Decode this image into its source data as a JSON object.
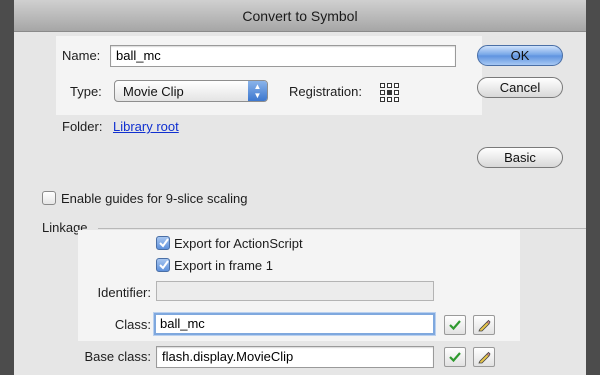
{
  "dialog": {
    "title": "Convert to Symbol"
  },
  "form": {
    "name_label": "Name:",
    "name_value": "ball_mc",
    "type_label": "Type:",
    "type_value": "Movie Clip",
    "registration_label": "Registration:",
    "folder_label": "Folder:",
    "folder_link": "Library root"
  },
  "buttons": {
    "ok": "OK",
    "cancel": "Cancel",
    "basic": "Basic"
  },
  "options": {
    "nine_slice": "Enable guides for 9-slice scaling",
    "nine_slice_checked": false
  },
  "linkage": {
    "title": "Linkage",
    "export_actionscript": "Export for ActionScript",
    "export_actionscript_checked": true,
    "export_frame1": "Export in frame 1",
    "export_frame1_checked": true,
    "identifier_label": "Identifier:",
    "identifier_value": "",
    "class_label": "Class:",
    "class_value": "ball_mc",
    "base_class_label": "Base class:",
    "base_class_value": "flash.display.MovieClip"
  },
  "colors": {
    "accent_blue": "#5e91dc",
    "check_green": "#2f9a2f",
    "link_blue": "#1030d0"
  }
}
